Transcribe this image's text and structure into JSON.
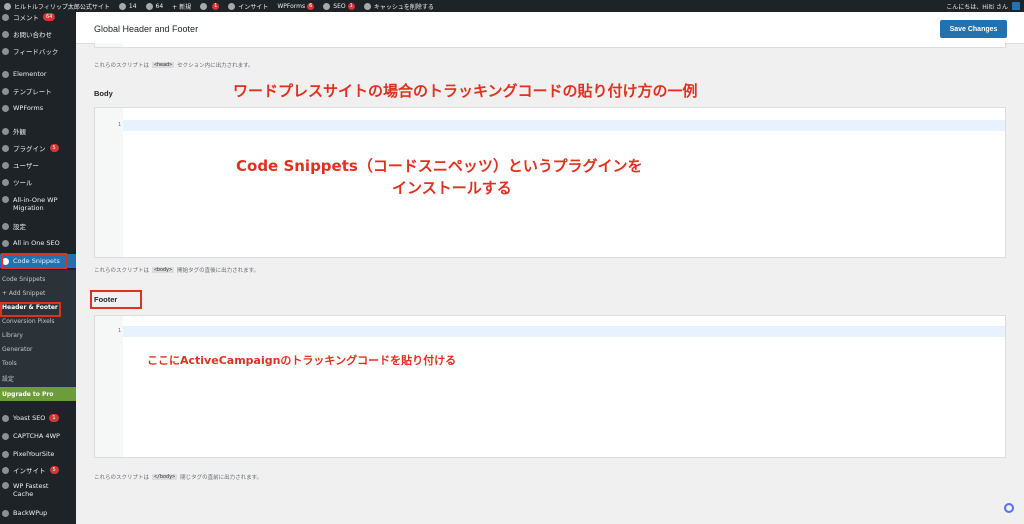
{
  "adminbar": {
    "items": [
      {
        "label": "ヒルトルフィリップ太郎公式サイト",
        "badge": ""
      },
      {
        "label": "14",
        "badge": ""
      },
      {
        "label": "64",
        "badge": ""
      },
      {
        "label": "+ 新規",
        "badge": ""
      },
      {
        "label": "",
        "badge": "1"
      },
      {
        "label": "インサイト",
        "badge": ""
      },
      {
        "label": "WPForms",
        "badge": "6"
      },
      {
        "label": "SEO",
        "badge": "1"
      },
      {
        "label": "キャッシュを削除する",
        "badge": ""
      }
    ],
    "greeting": "こんにちは、Hilti さん"
  },
  "sidebar": {
    "items": [
      {
        "label": "コメント",
        "count": "64"
      },
      {
        "label": "お問い合わせ",
        "count": ""
      },
      {
        "label": "フィードバック",
        "count": ""
      },
      {
        "label": "Elementor",
        "count": ""
      },
      {
        "label": "テンプレート",
        "count": ""
      },
      {
        "label": "WPForms",
        "count": ""
      },
      {
        "label": "外観",
        "count": ""
      },
      {
        "label": "プラグイン",
        "count": "5"
      },
      {
        "label": "ユーザー",
        "count": ""
      },
      {
        "label": "ツール",
        "count": ""
      },
      {
        "label": "All-in-One WP Migration",
        "count": ""
      },
      {
        "label": "設定",
        "count": ""
      },
      {
        "label": "All in One SEO",
        "count": ""
      },
      {
        "label": "Code Snippets",
        "count": ""
      },
      {
        "label": "Yoast SEO",
        "count": "1"
      },
      {
        "label": "CAPTCHA 4WP",
        "count": ""
      },
      {
        "label": "PixelYourSite",
        "count": ""
      },
      {
        "label": "インサイト",
        "count": "5"
      },
      {
        "label": "WP Fastest Cache",
        "count": ""
      },
      {
        "label": "BackWPup",
        "count": ""
      }
    ],
    "submenu": [
      "Code Snippets",
      "+ Add Snippet",
      "Header & Footer",
      "Conversion Pixels",
      "Library",
      "Generator",
      "Tools",
      "設定"
    ],
    "upgrade": "Upgrade to Pro"
  },
  "header": {
    "title": "Global Header and Footer",
    "save_label": "Save Changes"
  },
  "content": {
    "head_help": {
      "prefix": "これらのスクリプトは",
      "tag": "<head>",
      "suffix": "セクション内に出力されます。"
    },
    "body_label": "Body",
    "body_help": {
      "prefix": "これらのスクリプトは",
      "tag": "<body>",
      "suffix": "開始タグの直後に出力されます。"
    },
    "footer_label": "Footer",
    "footer_help": {
      "prefix": "これらのスクリプトは",
      "tag": "</body>",
      "suffix": "閉じタグの直前に出力されます。"
    },
    "line_number": "1"
  },
  "annotations": {
    "title": "ワードプレスサイトの場合のトラッキングコードの貼り付け方の一例",
    "step1_line1": "Code Snippets（コードスニペッツ）というプラグインを",
    "step1_line2": "インストールする",
    "step2": "ここにActiveCampaignのトラッキングコードを貼り付ける"
  },
  "colors": {
    "accent": "#2271b1",
    "annotation": "#e0301e",
    "sidebar_bg": "#1d2327",
    "upgrade_bg": "#6d9c3b"
  }
}
